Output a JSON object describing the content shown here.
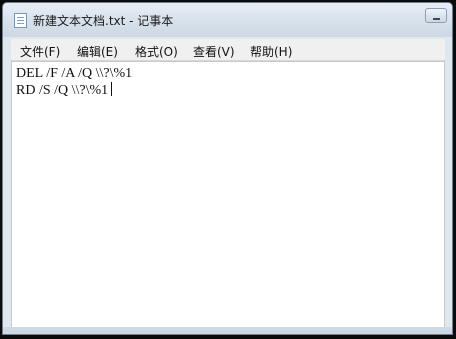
{
  "window": {
    "title": "新建文本文档.txt - 记事本"
  },
  "menu": {
    "items": [
      {
        "label": "文件(F)"
      },
      {
        "label": "编辑(E)"
      },
      {
        "label": "格式(O)"
      },
      {
        "label": "查看(V)"
      },
      {
        "label": "帮助(H)"
      }
    ]
  },
  "editor": {
    "lines": [
      "DEL /F /A /Q \\\\?\\%1",
      "RD /S /Q \\\\?\\%1"
    ]
  },
  "icons": {
    "title_icon": "notepad-icon",
    "minimize_icon": "minimize-icon"
  },
  "colors": {
    "titlebar": "#d7e1eb",
    "menubar": "#f0f0f0",
    "editor_bg": "#ffffff",
    "outer_bg": "#0b0b0b"
  }
}
